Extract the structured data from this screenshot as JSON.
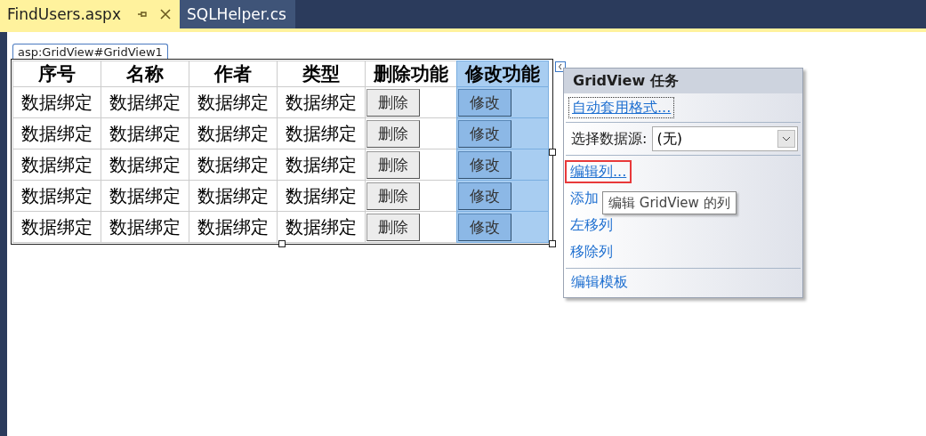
{
  "tabs": [
    {
      "label": "FindUsers.aspx",
      "selected": true
    },
    {
      "label": "SQLHelper.cs",
      "selected": false
    }
  ],
  "control_tag": "asp:GridView#GridView1",
  "grid": {
    "columns": [
      {
        "label": "序号",
        "kind": "text",
        "selected": false
      },
      {
        "label": "名称",
        "kind": "text",
        "selected": false
      },
      {
        "label": "作者",
        "kind": "text",
        "selected": false
      },
      {
        "label": "类型",
        "kind": "text",
        "selected": false
      },
      {
        "label": "删除功能",
        "kind": "button",
        "selected": false
      },
      {
        "label": "修改功能",
        "kind": "button",
        "selected": true
      }
    ],
    "rows": [
      [
        "数据绑定",
        "数据绑定",
        "数据绑定",
        "数据绑定",
        "删除",
        "修改"
      ],
      [
        "数据绑定",
        "数据绑定",
        "数据绑定",
        "数据绑定",
        "删除",
        "修改"
      ],
      [
        "数据绑定",
        "数据绑定",
        "数据绑定",
        "数据绑定",
        "删除",
        "修改"
      ],
      [
        "数据绑定",
        "数据绑定",
        "数据绑定",
        "数据绑定",
        "删除",
        "修改"
      ],
      [
        "数据绑定",
        "数据绑定",
        "数据绑定",
        "数据绑定",
        "删除",
        "修改"
      ]
    ]
  },
  "tasks_panel": {
    "title": "GridView 任务",
    "auto_format": "自动套用格式...",
    "data_source": {
      "label": "选择数据源:",
      "value": "(无)"
    },
    "actions": [
      {
        "label": "编辑列...",
        "highlighted": true
      },
      {
        "label": "添加",
        "highlighted": false
      },
      {
        "label": "左移列",
        "highlighted": false
      },
      {
        "label": "移除列",
        "highlighted": false
      }
    ],
    "template_action": "编辑模板",
    "tooltip": "编辑 GridView 的列"
  }
}
